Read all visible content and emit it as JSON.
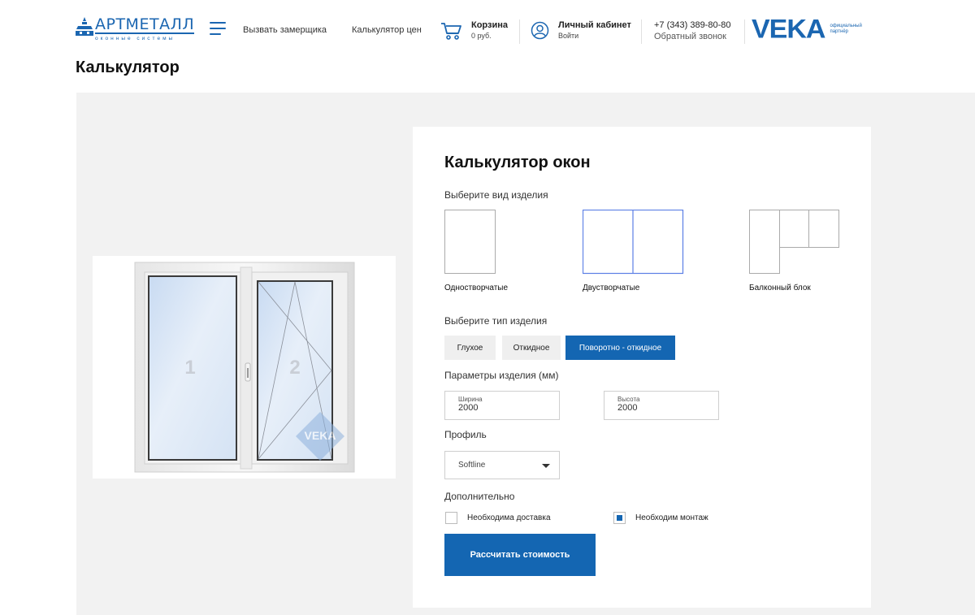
{
  "header": {
    "logo": {
      "name": "АРТМЕТАЛЛ",
      "sub": "оконные системы"
    },
    "nav": [
      {
        "label": "Вызвать замерщика"
      },
      {
        "label": "Калькулятор цен"
      }
    ],
    "cart": {
      "title": "Корзина",
      "sum": "0 руб."
    },
    "account": {
      "title": "Личный кабинет",
      "action": "Войти"
    },
    "phone": {
      "number": "+7 (343) 389-80-80",
      "callback": "Обратный звонок"
    },
    "partner": {
      "brand": "VEKA",
      "note_line1": "официальный",
      "note_line2": "партнёр"
    }
  },
  "page": {
    "title": "Калькулятор"
  },
  "preview": {
    "sash_numbers": [
      "1",
      "2"
    ],
    "watermark": "VEKA"
  },
  "calculator": {
    "title": "Калькулятор окон",
    "product_kind_label": "Выберите вид изделия",
    "product_kinds": [
      {
        "label": "Одностворчатые",
        "selected": false
      },
      {
        "label": "Двустворчатые",
        "selected": true
      },
      {
        "label": "Балконный блок",
        "selected": false
      }
    ],
    "opening_type_label": "Выберите тип изделия",
    "opening_types": [
      {
        "label": "Глухое",
        "selected": false
      },
      {
        "label": "Откидное",
        "selected": false
      },
      {
        "label": "Поворотно - откидное",
        "selected": true
      }
    ],
    "params_label": "Параметры изделия (мм)",
    "width": {
      "label": "Ширина",
      "value": "2000"
    },
    "height": {
      "label": "Высота",
      "value": "2000"
    },
    "profile_label": "Профиль",
    "profile_value": "Softline",
    "extras_label": "Дополнительно",
    "extras": [
      {
        "label": "Необходима доставка",
        "checked": false
      },
      {
        "label": "Необходим монтаж",
        "checked": true
      }
    ],
    "submit_label": "Рассчитать стоимость"
  },
  "colors": {
    "brand_blue": "#1b66b1",
    "button_blue": "#1466b2",
    "selection_outline": "#5b7fe6",
    "background_gray": "#f2f2f2"
  },
  "icons": {
    "menu": "hamburger-icon",
    "cart": "cart-icon",
    "account": "user-circle-icon",
    "select": "caret-down-icon"
  }
}
